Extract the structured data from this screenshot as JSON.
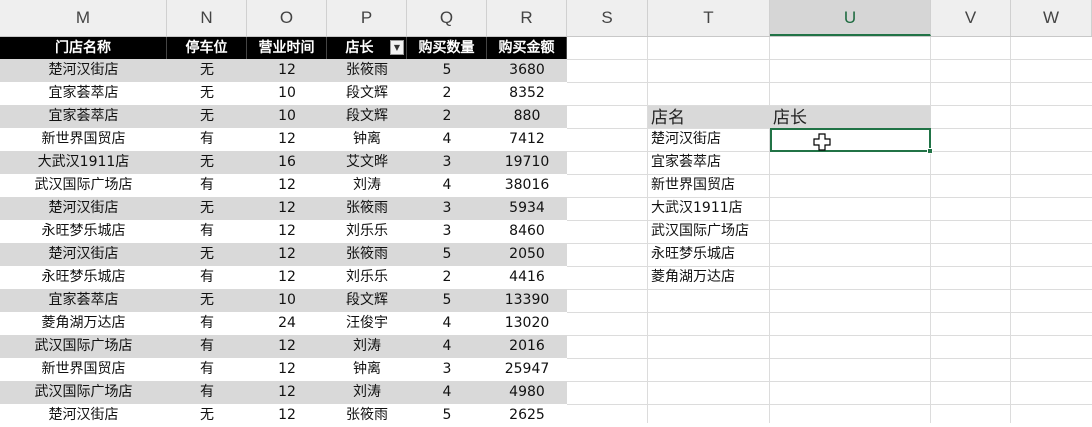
{
  "columns": [
    "M",
    "N",
    "O",
    "P",
    "Q",
    "R",
    "S",
    "T",
    "U",
    "V",
    "W"
  ],
  "selected_column": "U",
  "table": {
    "headers": [
      "门店名称",
      "停车位",
      "营业时间",
      "店长",
      "购买数量",
      "购买金额"
    ],
    "filter_column": "店长",
    "rows": [
      [
        "楚河汉街店",
        "无",
        "12",
        "张筱雨",
        "5",
        "3680"
      ],
      [
        "宜家荟萃店",
        "无",
        "10",
        "段文辉",
        "2",
        "8352"
      ],
      [
        "宜家荟萃店",
        "无",
        "10",
        "段文辉",
        "2",
        "880"
      ],
      [
        "新世界国贸店",
        "有",
        "12",
        "钟离",
        "4",
        "7412"
      ],
      [
        "大武汉1911店",
        "无",
        "16",
        "艾文晔",
        "3",
        "19710"
      ],
      [
        "武汉国际广场店",
        "有",
        "12",
        "刘涛",
        "4",
        "38016"
      ],
      [
        "楚河汉街店",
        "无",
        "12",
        "张筱雨",
        "3",
        "5934"
      ],
      [
        "永旺梦乐城店",
        "有",
        "12",
        "刘乐乐",
        "3",
        "8460"
      ],
      [
        "楚河汉街店",
        "无",
        "12",
        "张筱雨",
        "5",
        "2050"
      ],
      [
        "永旺梦乐城店",
        "有",
        "12",
        "刘乐乐",
        "2",
        "4416"
      ],
      [
        "宜家荟萃店",
        "无",
        "10",
        "段文辉",
        "5",
        "13390"
      ],
      [
        "菱角湖万达店",
        "有",
        "24",
        "汪俊宇",
        "4",
        "13020"
      ],
      [
        "武汉国际广场店",
        "有",
        "12",
        "刘涛",
        "4",
        "2016"
      ],
      [
        "新世界国贸店",
        "有",
        "12",
        "钟离",
        "3",
        "25947"
      ],
      [
        "武汉国际广场店",
        "有",
        "12",
        "刘涛",
        "4",
        "4980"
      ],
      [
        "楚河汉街店",
        "无",
        "12",
        "张筱雨",
        "5",
        "2625"
      ]
    ]
  },
  "lookup": {
    "header_store": "店名",
    "header_manager": "店长",
    "stores": [
      "楚河汉街店",
      "宜家荟萃店",
      "新世界国贸店",
      "大武汉1911店",
      "武汉国际广场店",
      "永旺梦乐城店",
      "菱角湖万达店"
    ]
  },
  "icons": {
    "filter": "filter-dropdown-icon",
    "cursor": "cell-select-cursor-icon"
  },
  "colors": {
    "header_bg": "#000000",
    "alt_row": "#d9d9d9",
    "accent": "#217346"
  }
}
